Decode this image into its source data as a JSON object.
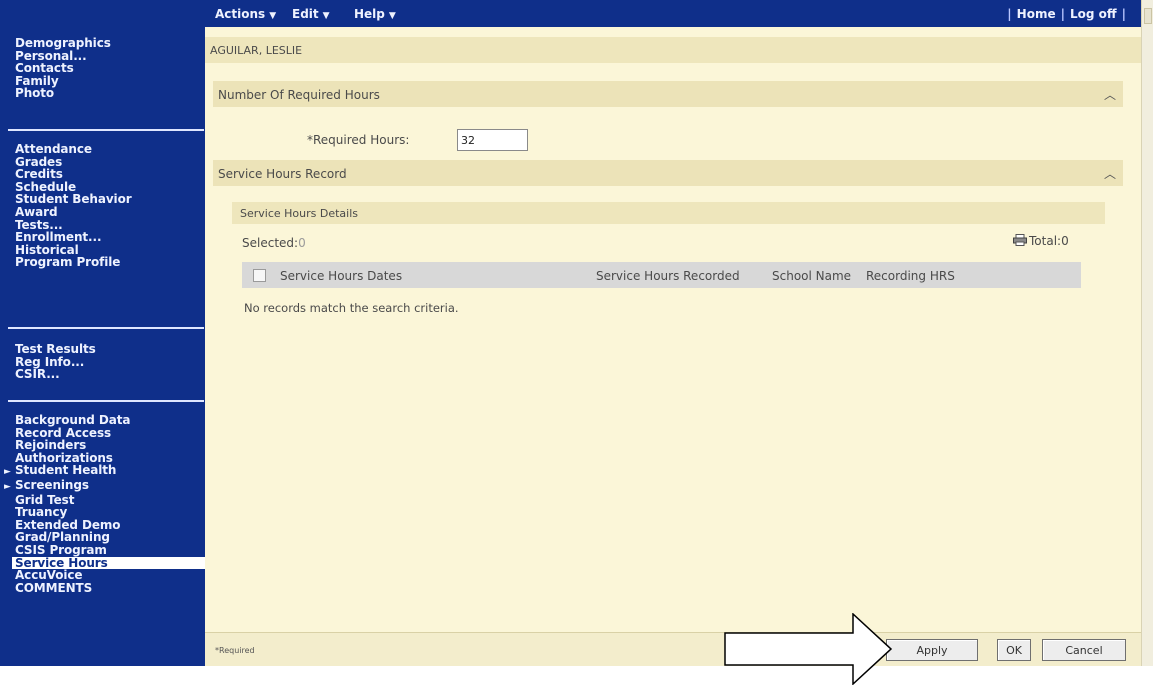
{
  "topbar": {
    "menus": [
      {
        "label": "Actions"
      },
      {
        "label": "Edit"
      },
      {
        "label": "Help"
      }
    ],
    "links": [
      "Home",
      "Log off"
    ],
    "separator": "|"
  },
  "sidebar": {
    "groups": [
      {
        "items": [
          "Demographics",
          "Personal...",
          "Contacts",
          "Family",
          "Photo"
        ]
      },
      {
        "items": [
          "Attendance",
          "Grades",
          "Credits",
          "Schedule",
          "Student Behavior",
          "Award",
          "Tests...",
          "Enrollment...",
          "Historical",
          "Program Profile"
        ]
      },
      {
        "items": [
          "Test Results",
          "Reg Info...",
          "CSIR..."
        ]
      },
      {
        "items": [
          "Background Data",
          "Record Access",
          "Rejoinders",
          "Authorizations",
          "Student Health",
          "Screenings",
          "Grid Test",
          "Truancy",
          "Extended Demo",
          "Grad/Planning",
          "CSIS Program",
          "Service Hours",
          "AccuVoice",
          "COMMENTS"
        ]
      }
    ],
    "expandable_items": [
      "Student Health",
      "Screenings"
    ],
    "selected_item": "Service Hours"
  },
  "student": {
    "name": "AGUILAR, LESLIE"
  },
  "required_hours_section": {
    "title": "Number Of Required Hours",
    "field_label": "*Required Hours:",
    "field_value": "32"
  },
  "service_hours_section": {
    "title": "Service Hours Record",
    "details_title": "Service Hours Details",
    "selected_label": "Selected:",
    "selected_value": "0",
    "total_label": "Total:",
    "total_value": "0",
    "columns": [
      "Service Hours Dates",
      "Service Hours Recorded",
      "School Name",
      "Recording HRS"
    ],
    "empty_message": "No records match the search criteria."
  },
  "footer": {
    "required_note": "*Required",
    "buttons": {
      "apply": "Apply",
      "ok": "OK",
      "cancel": "Cancel"
    }
  },
  "colors": {
    "nav_blue": "#0f2f8a",
    "panel_bg": "#fbf6d8",
    "section_bg": "#ece3b8",
    "table_header_bg": "#d8d8d8"
  },
  "icons": [
    "chevron-up-icon",
    "printer-icon",
    "caret-down-icon",
    "arrow-right-pointer-icon"
  ]
}
